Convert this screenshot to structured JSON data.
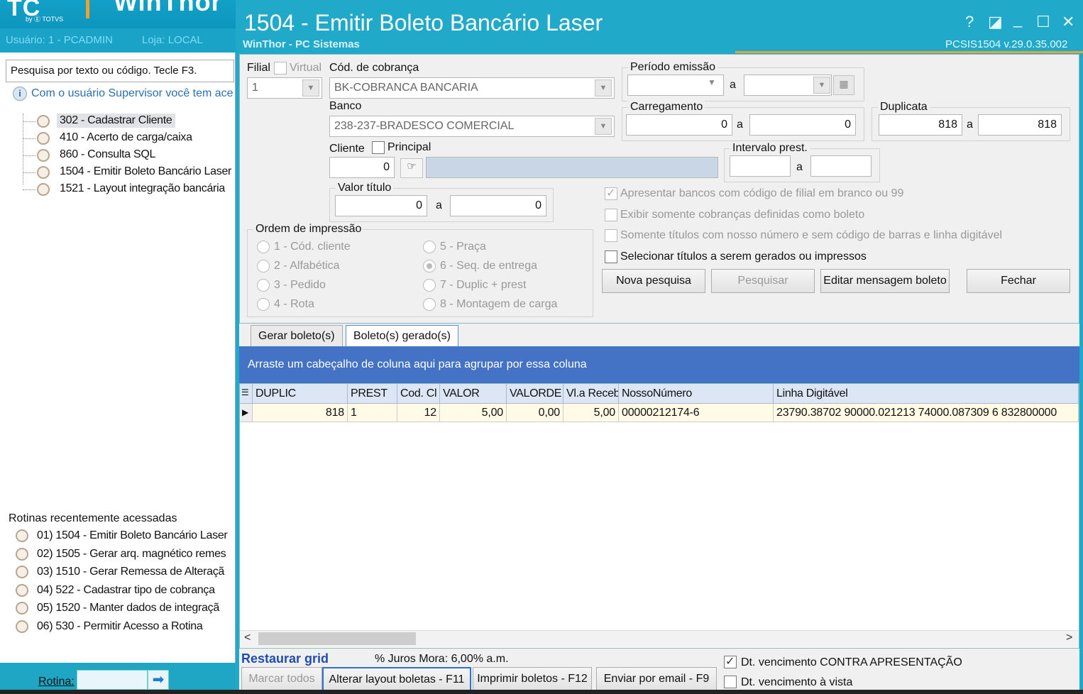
{
  "shell": {
    "logo": "TC",
    "logo_small": "by ⓖ TOTVS",
    "brand": "WinThor",
    "user": "Usuário: 1 - PCADMIN",
    "store": "Loja: LOCAL",
    "search_placeholder": "Pesquisa por texto ou código. Tecle F3.",
    "info": "Com o usuário Supervisor você tem ace",
    "tree": [
      {
        "label": "302 - Cadastrar Cliente"
      },
      {
        "label": "410 - Acerto de carga/caixa"
      },
      {
        "label": "860 - Consulta SQL"
      },
      {
        "label": "1504 - Emitir Boleto Bancário Laser"
      },
      {
        "label": "1521 - Layout integração bancária"
      }
    ],
    "recent_title": "Rotinas recentemente acessadas",
    "recent": [
      {
        "label": "01)  1504 - Emitir Boleto Bancário Laser"
      },
      {
        "label": "02)  1505 - Gerar arq. magnético remes"
      },
      {
        "label": "03)  1510 - Gerar Remessa de Alteraçã"
      },
      {
        "label": "04)  522 - Cadastrar tipo de cobrança"
      },
      {
        "label": "05)  1520 - Manter dados de integraçã"
      },
      {
        "label": "06)  530 - Permitir Acesso a Rotina"
      }
    ],
    "rotina_label": "Rotina:",
    "go_icon": "➡"
  },
  "window": {
    "title": "1504 - Emitir Boleto Bancário Laser",
    "subtitle": "WinThor - PC Sistemas",
    "version": "PCSIS1504  v.29.0.35.002",
    "btn_help": "?",
    "btn_restore2": "◪",
    "btn_min": "_",
    "btn_max": "☐",
    "btn_close": "✕"
  },
  "form": {
    "filial_label": "Filial",
    "filial_value": "1",
    "virtual_label": "Virtual",
    "cobranca_label": "Cód. de cobrança",
    "cobranca_value": "BK-COBRANCA BANCARIA",
    "banco_label": "Banco",
    "banco_value": "238-237-BRADESCO COMERCIAL",
    "periodo_label": "Período emissão",
    "a": "a",
    "carregamento_label": "Carregamento",
    "carreg_from": "0",
    "carreg_to": "0",
    "duplicata_label": "Duplicata",
    "dup_from": "818",
    "dup_to": "818",
    "cliente_label": "Cliente",
    "principal_label": "Principal",
    "cliente_value": "0",
    "intervalo_label": "Intervalo prest.",
    "valor_label": "Valor título",
    "valor_from": "0",
    "valor_to": "0",
    "opt1": "Apresentar bancos com código de filial em branco ou 99",
    "opt2": "Exibir somente cobranças definidas como boleto",
    "opt3": "Somente títulos com nosso número e sem código de barras e linha digitável",
    "opt4": "Selecionar títulos a serem gerados ou impressos",
    "ordem_label": "Ordem de impressão",
    "ordem": [
      "1 - Cód. cliente",
      "2 - Alfabética",
      "3 - Pedido",
      "4 - Rota",
      "5 - Praça",
      "6 - Seq. de entrega",
      "7 - Duplic + prest",
      "8 - Montagem de carga"
    ],
    "btn_nova": "Nova pesquisa",
    "btn_pesquisar": "Pesquisar",
    "btn_editar": "Editar mensagem boleto",
    "btn_fechar": "Fechar"
  },
  "tabs": [
    "Gerar boleto(s)",
    "Boleto(s) gerado(s)"
  ],
  "group_hint": "Arraste um cabeçalho de coluna aqui para agrupar por essa coluna",
  "grid": {
    "columns": [
      "DUPLIC",
      "PREST",
      "Cod. Cl",
      "VALOR",
      "VALORDE",
      "Vl.a Receb",
      "NossoNúmero",
      "Linha Digitável"
    ],
    "rows": [
      [
        "818",
        "1",
        "12",
        "5,00",
        "0,00",
        "5,00",
        "00000212174-6",
        "23790.38702  90000.021213  74000.087309  6  832800000"
      ]
    ]
  },
  "bottom": {
    "restaurar": "Restaurar grid",
    "juros": "% Juros Mora: 6,00% a.m.",
    "chk1": "Dt. vencimento CONTRA APRESENTAÇÃO",
    "chk2": "Dt. vencimento à vista",
    "btn_marcar": "Marcar todos",
    "btn_alterar": "Alterar layout boletas - F11",
    "btn_imprimir": "Imprimir boletos - F12",
    "btn_enviar": "Enviar por email - F9"
  }
}
